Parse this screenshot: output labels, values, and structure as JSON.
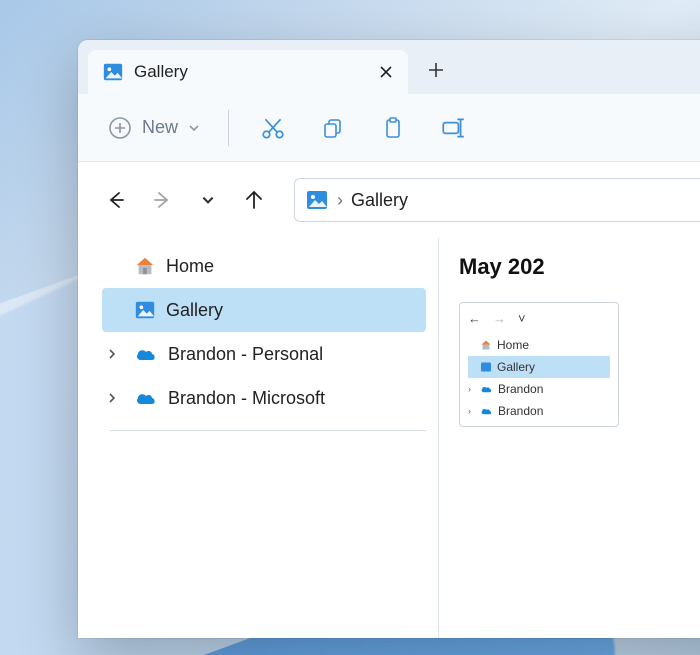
{
  "tab": {
    "title": "Gallery"
  },
  "toolbar": {
    "new_label": "New"
  },
  "breadcrumb": {
    "location": "Gallery"
  },
  "sidebar": {
    "items": [
      {
        "label": "Home"
      },
      {
        "label": "Gallery"
      },
      {
        "label": "Brandon - Personal"
      },
      {
        "label": "Brandon - Microsoft"
      }
    ]
  },
  "content": {
    "month_label": "May 202",
    "mini_sidebar": [
      {
        "label": "Home"
      },
      {
        "label": "Gallery"
      },
      {
        "label": "Brandon"
      },
      {
        "label": "Brandon"
      }
    ]
  }
}
